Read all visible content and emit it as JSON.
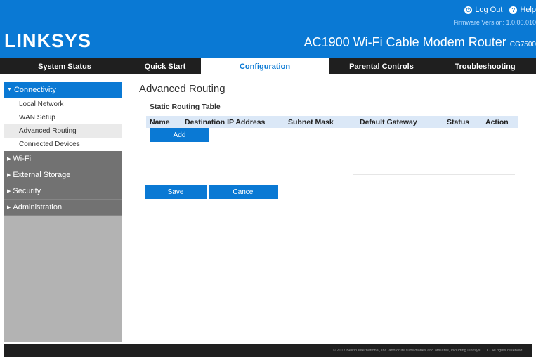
{
  "header": {
    "logo": "LINKSYS",
    "logout_label": "Log Out",
    "help_label": "Help",
    "firmware": "Firmware Version: 1.0.00.010",
    "model_name": "AC1900 Wi-Fi Cable Modem Router",
    "model_code": "CG7500"
  },
  "nav": {
    "tabs": [
      {
        "label": "System Status"
      },
      {
        "label": "Quick Start"
      },
      {
        "label": "Configuration"
      },
      {
        "label": "Parental Controls"
      },
      {
        "label": "Troubleshooting"
      }
    ],
    "active_tab": "Configuration"
  },
  "sidebar": {
    "connectivity": "Connectivity",
    "subitems": [
      {
        "label": "Local Network"
      },
      {
        "label": "WAN Setup"
      },
      {
        "label": "Advanced Routing"
      },
      {
        "label": "Connected Devices"
      }
    ],
    "sections": [
      {
        "label": "Wi-Fi"
      },
      {
        "label": "External Storage"
      },
      {
        "label": "Security"
      },
      {
        "label": "Administration"
      }
    ]
  },
  "main": {
    "title": "Advanced Routing",
    "section_title": "Static Routing Table",
    "table_headers": [
      "Name",
      "Destination IP Address",
      "Subnet Mask",
      "Default Gateway",
      "Status",
      "Action"
    ],
    "add_label": "Add",
    "save_label": "Save",
    "cancel_label": "Cancel"
  },
  "footer": {
    "copyright": "© 2017 Belkin International, Inc. and/or its subsidiaries and affiliates, including Linksys, LLC. All rights reserved."
  },
  "colors": {
    "brand_blue": "#0a79d4",
    "nav_dark": "#1f1f1f",
    "sidebar_gray": "#727272",
    "table_header_bg": "#dbe8f7"
  }
}
